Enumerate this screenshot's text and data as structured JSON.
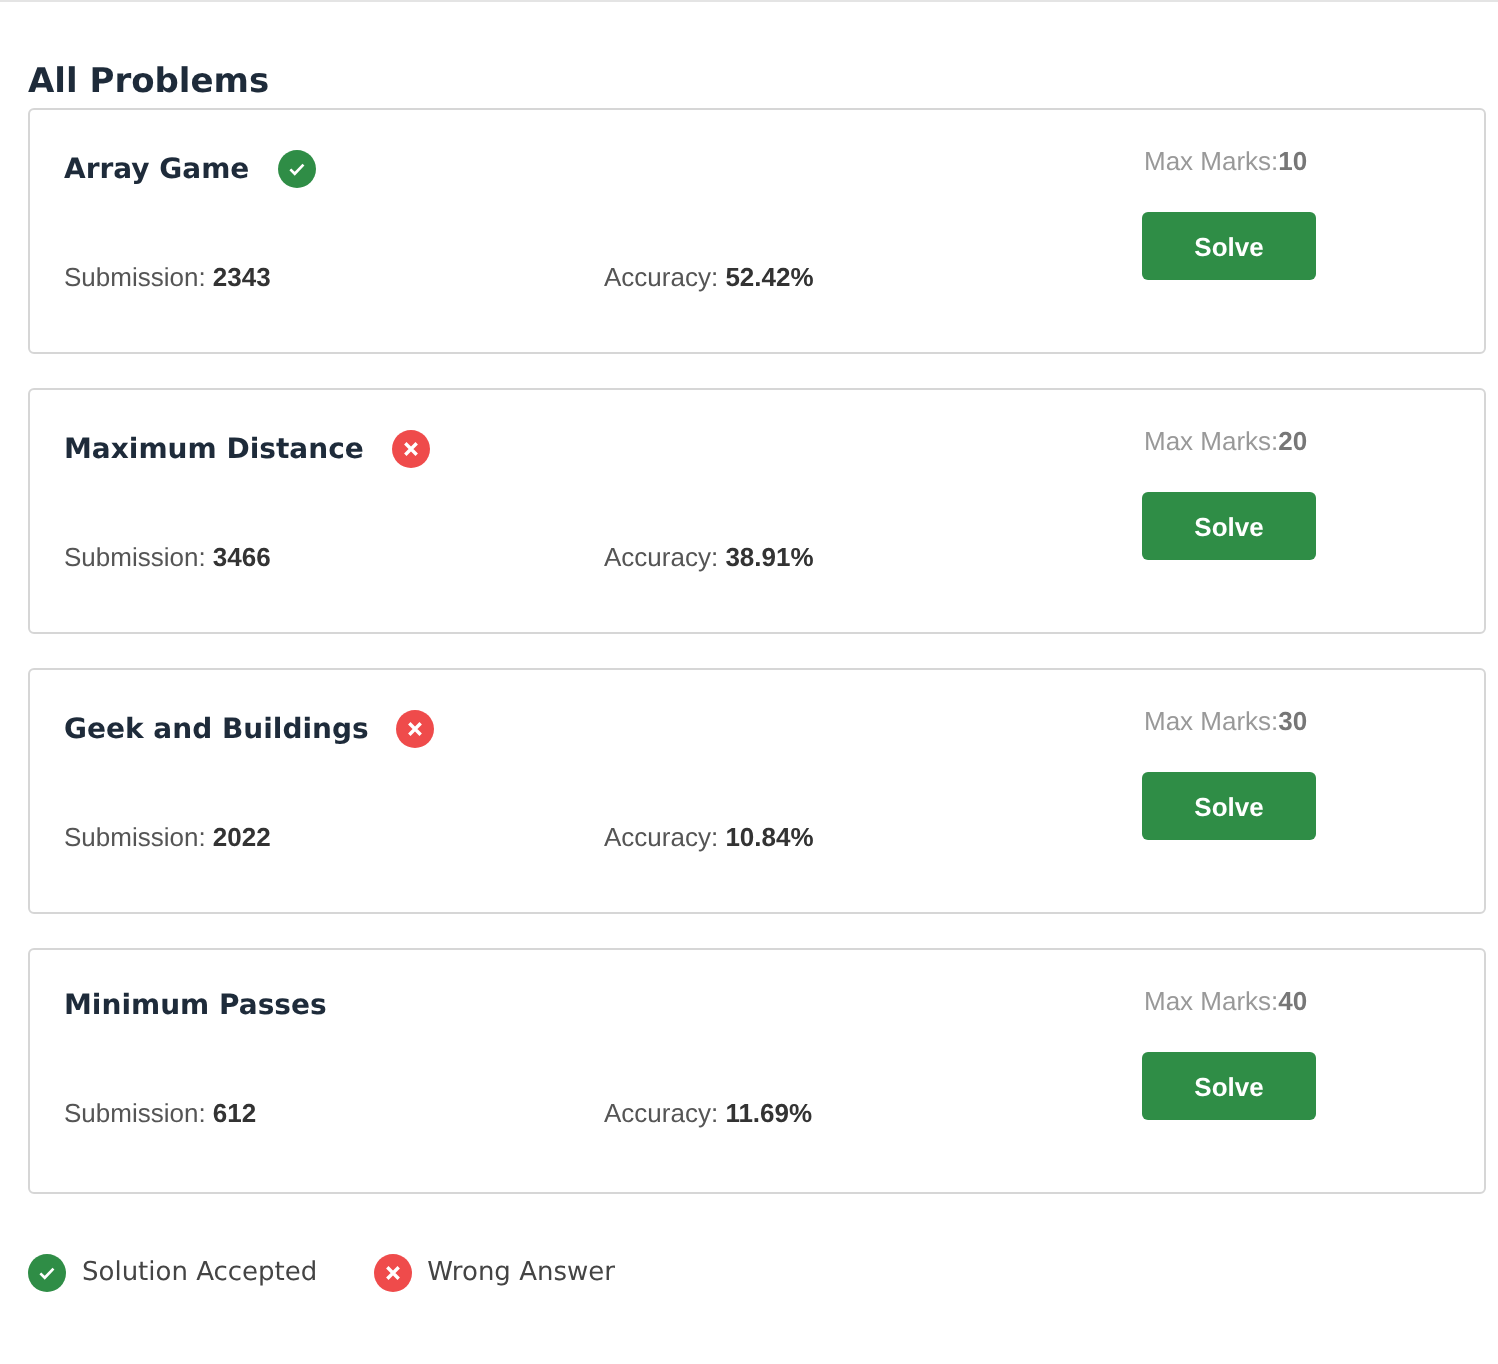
{
  "heading": "All Problems",
  "problems": [
    {
      "title": "Array Game",
      "kind": "accepted",
      "max_marks": "Max Marks:**10**",
      "submission": "Submission: **2343**",
      "accuracy": "Accuracy: **52.42%**",
      "button": "Solve"
    },
    {
      "title": "Maximum Distance",
      "kind": "wrong",
      "max_marks": "Max Marks:**20**",
      "submission": "Submission: **3466**",
      "accuracy": "Accuracy: **38.91%**",
      "button": "Solve"
    },
    {
      "title": "Geek and Buildings",
      "kind": "wrong",
      "max_marks": "Max Marks:**30**",
      "submission": "Submission: **2022**",
      "accuracy": "Accuracy: **10.84%**",
      "button": "Solve"
    },
    {
      "title": "Minimum Passes",
      "kind": "unattempted",
      "max_marks": "Max Marks:**40**",
      "submission": "Submission: **612**",
      "accuracy": "Accuracy: **11.69%**",
      "button": "Solve"
    }
  ],
  "legend": [
    {
      "kind": "accepted",
      "label": "Solution Accepted"
    },
    {
      "kind": "wrong",
      "label": "Wrong Answer"
    }
  ]
}
